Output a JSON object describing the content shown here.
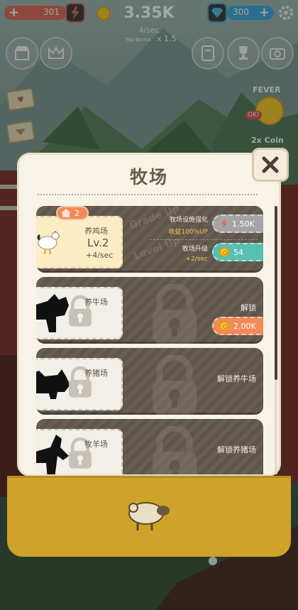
{
  "hud": {
    "energy_value": "301",
    "coin_total": "3.35K",
    "rate": "4/sec",
    "top_bonus_label": "Top Bonus",
    "top_bonus_multiplier": "x 1.5",
    "gem_value": "300",
    "fever_label": "FEVER",
    "fever_badge": "OK!",
    "coin_boost_label": "2x Coin"
  },
  "modal": {
    "title": "牧场",
    "farms": [
      {
        "name": "养鸡场",
        "level": "Lv.2",
        "rate": "+4/sec",
        "house_count": "2",
        "watermark_1": "Grade Up",
        "watermark_2": "Level Up",
        "upgrade_line1": "牧场设施强化",
        "upgrade_line2": "收益100%UP",
        "upgrade_cost": "1.50K",
        "level_line1": "牧场升级",
        "level_line2": "+2/sec",
        "level_cost": "54"
      },
      {
        "name": "养牛场",
        "unlock_label": "解锁",
        "unlock_cost": "2.00K"
      },
      {
        "name": "养猪场",
        "unlock_label": "解锁养牛场"
      },
      {
        "name": "牧羊场",
        "unlock_label": "解锁养猪场"
      }
    ]
  },
  "colors": {
    "energy_bar": "#e0685a",
    "gem_bar": "#3fa6d9",
    "coin": "#f6c62b",
    "upgrade_btn": "#a4a4a4",
    "level_btn": "#57c0b2",
    "unlock_btn": "#f08a58",
    "bottom_panel": "#cfa22a"
  },
  "icons": [
    "plus-icon",
    "lightning-icon",
    "coin-icon",
    "gem-icon",
    "gear-icon",
    "shop-icon",
    "crown-icon",
    "notebook-icon",
    "trophy-icon",
    "camera-icon",
    "letter-icon",
    "close-icon",
    "house-icon",
    "padlock-icon",
    "sheep-icon"
  ]
}
